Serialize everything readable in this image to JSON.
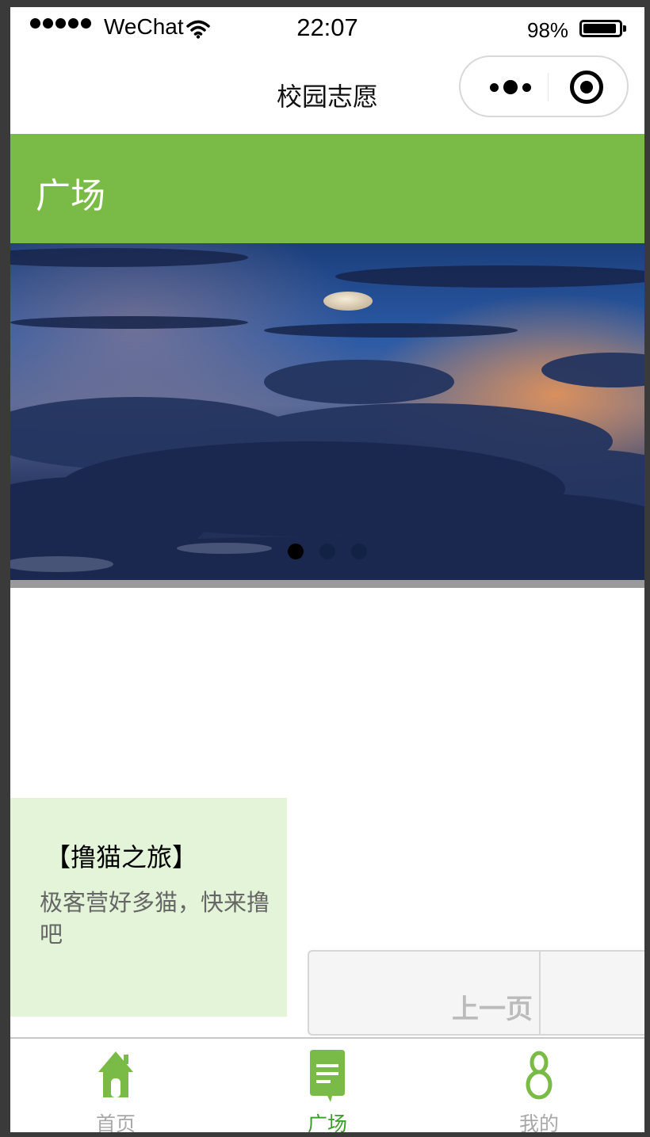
{
  "status_bar": {
    "carrier": "WeChat",
    "time": "22:07",
    "battery": "98%",
    "battery_level": 0.98
  },
  "nav": {
    "title": "校园志愿"
  },
  "header": {
    "title": "广场"
  },
  "banner": {
    "slide_count": 3,
    "active_index": 0
  },
  "card": {
    "title": "【撸猫之旅】",
    "description": "极客营好多猫，快来撸吧"
  },
  "pager": {
    "prev_label": "上一页"
  },
  "tabbar": {
    "items": [
      {
        "label": "首页",
        "icon": "home-icon",
        "active": false
      },
      {
        "label": "广场",
        "icon": "message-icon",
        "active": true
      },
      {
        "label": "我的",
        "icon": "person-icon",
        "active": false
      }
    ]
  },
  "colors": {
    "accent": "#7aba46",
    "active_tab": "#3a9d2a",
    "inactive_tab": "#a8a8a8",
    "card_bg": "#e3f4d8"
  }
}
